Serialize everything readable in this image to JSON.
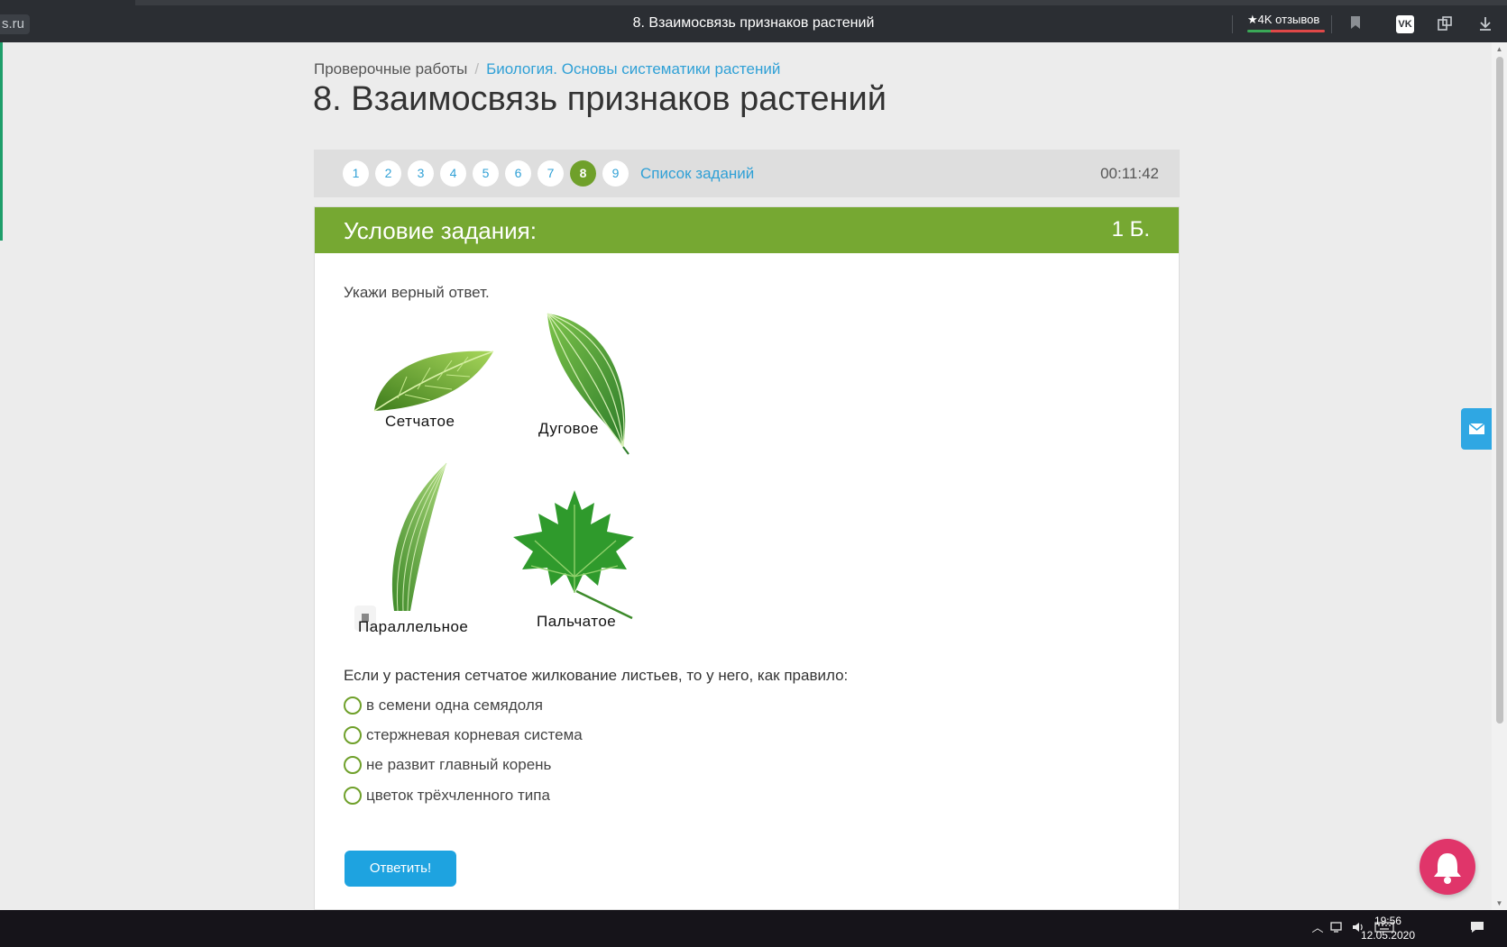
{
  "browser": {
    "domain": "s.ru",
    "tab_title": "8. Взаимосвязь признаков растений",
    "reviews_badge": "★4K отзывов"
  },
  "breadcrumb": {
    "root": "Проверочные работы",
    "separator": "/",
    "current": "Биология. Основы систематики растений"
  },
  "page_title": "8. Взаимосвязь признаков растений",
  "task_nav": {
    "numbers": [
      "1",
      "2",
      "3",
      "4",
      "5",
      "6",
      "7",
      "8",
      "9"
    ],
    "active": "8",
    "list_link": "Список заданий",
    "timer": "00:11:42"
  },
  "card": {
    "header_title": "Условие задания:",
    "points": "1 Б.",
    "instruction": "Укажи верный ответ.",
    "leaves": [
      {
        "label": "Сетчатое",
        "icon": "netted-leaf"
      },
      {
        "label": "Дуговое",
        "icon": "arcuate-leaf"
      },
      {
        "label": "Параллельное",
        "icon": "parallel-leaf"
      },
      {
        "label": "Пальчатое",
        "icon": "palmate-leaf"
      }
    ],
    "question": "Если у растения сетчатое жилкование листьев, то у него, как правило:",
    "options": [
      "в семени одна семядоля",
      "стержневая корневая система",
      "не развит главный корень",
      "цветок трёхчленного типа"
    ],
    "submit_label": "Ответить!"
  },
  "taskbar": {
    "time": "19:56",
    "date": "12.05.2020"
  },
  "colors": {
    "accent_green": "#76a832",
    "link_blue": "#2fa0d6",
    "button_blue": "#1ea3e0",
    "bell_pink": "#e0356a"
  }
}
